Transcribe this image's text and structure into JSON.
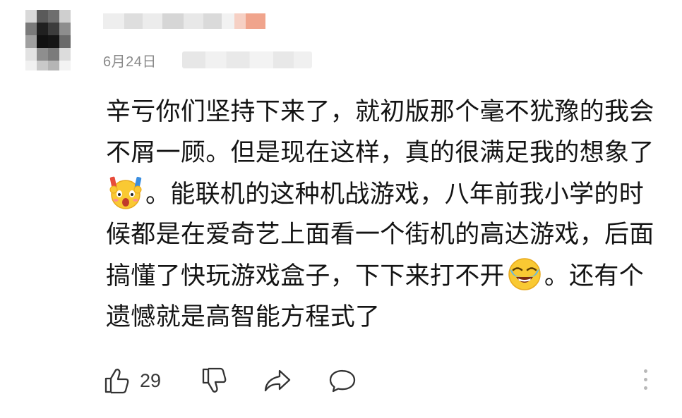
{
  "comment": {
    "date": "6月24日",
    "text_part1": "辛亏你们坚持下来了，就初版那个毫不犹豫的我会不屑一顾。但是现在这样，真的很满足我的想象了",
    "text_part2": "。能联机的这种机战游戏，八年前我小学的时候都是在爱奇艺上面看一个街机的高达游戏，后面搞懂了快玩游戏盒子，下下来打不开",
    "text_part3": "。还有个遗憾就是高智能方程式了",
    "emojis": [
      "emoji-cheering-icon",
      "emoji-laughing-crying-icon"
    ]
  },
  "actions": {
    "like_count": "29",
    "icons": [
      "thumbs-up-icon",
      "thumbs-down-icon",
      "share-icon",
      "reply-icon",
      "more-options-icon"
    ]
  },
  "colors": {
    "text": "#141414",
    "date": "#8a8a8a",
    "icon": "#333333",
    "dots": "#b8b8b8",
    "emoji_yellow": "#f9c933"
  }
}
